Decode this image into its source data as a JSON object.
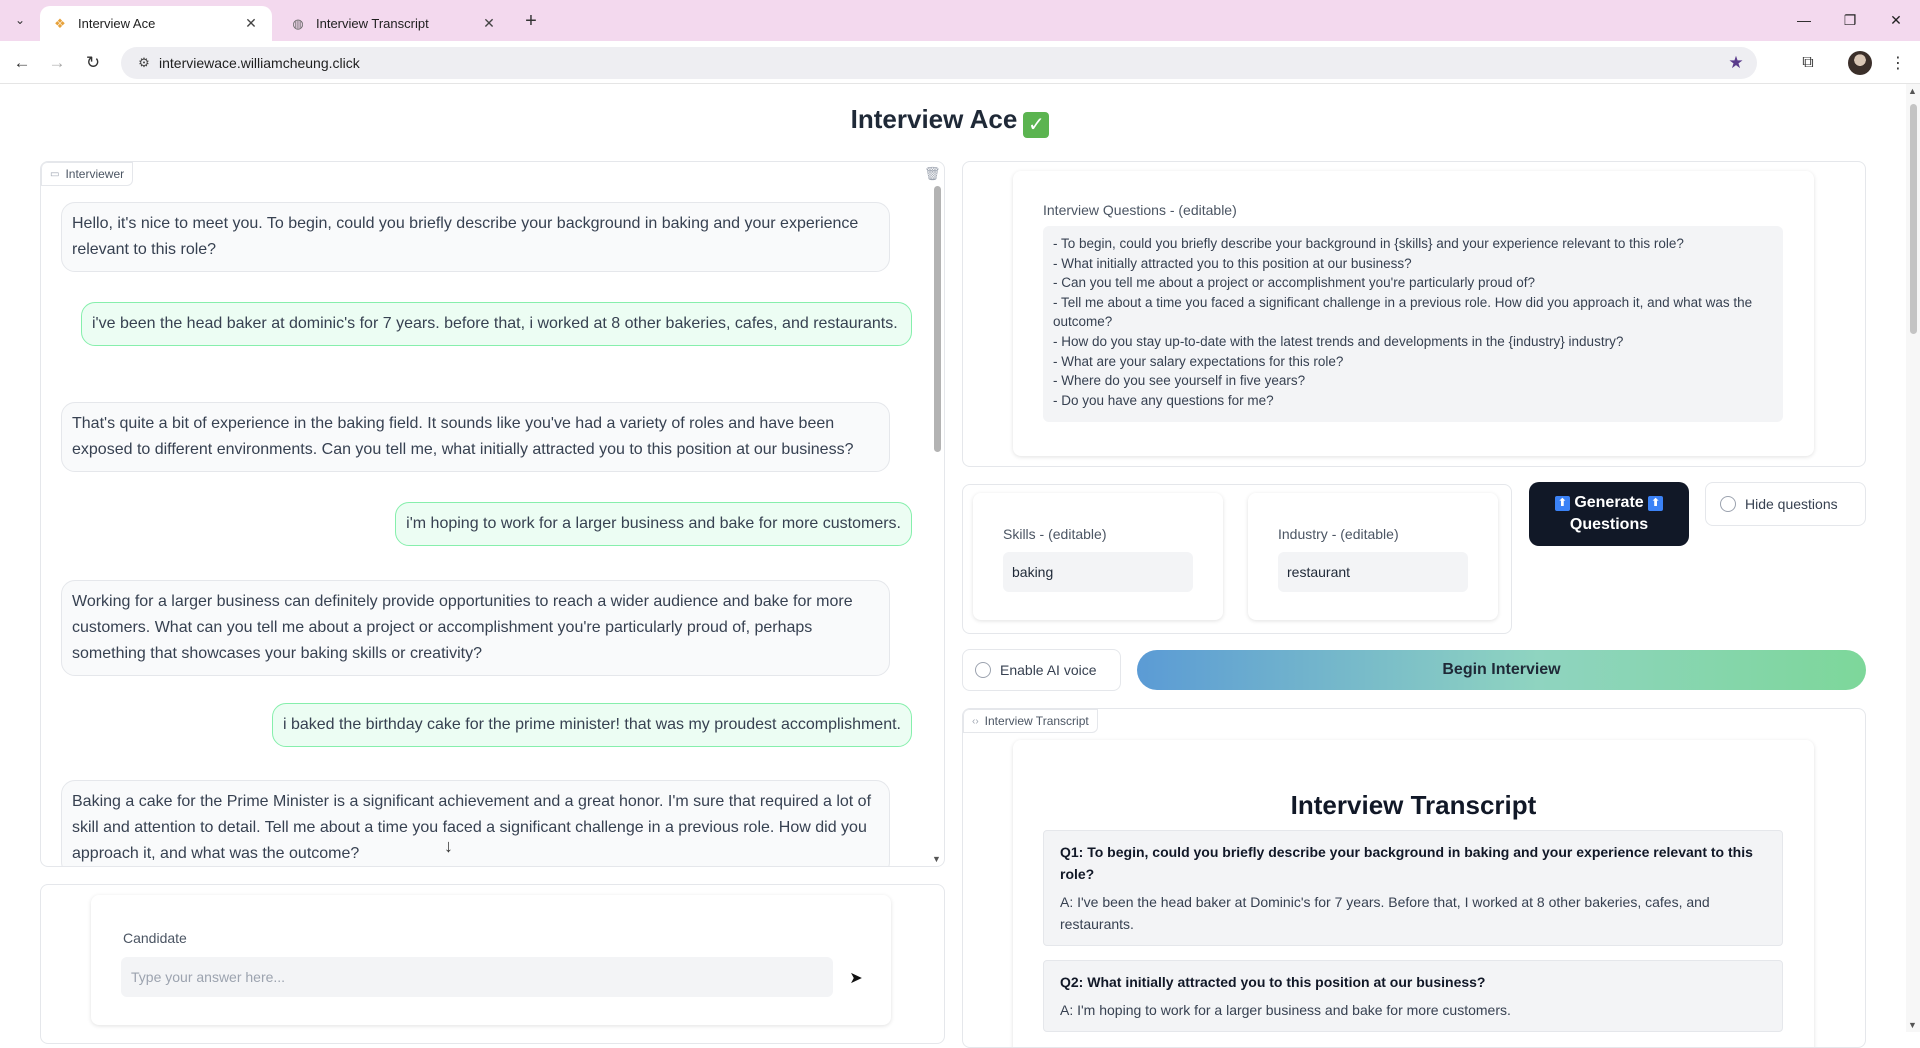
{
  "browser": {
    "tabs": [
      {
        "title": "Interview Ace",
        "favicon": "logo-icon",
        "active": true
      },
      {
        "title": "Interview Transcript",
        "favicon": "globe-icon",
        "active": false
      }
    ],
    "url": "interviewace.williamcheung.click"
  },
  "app": {
    "title": "Interview Ace",
    "title_emoji": "✓"
  },
  "chat": {
    "tag": "Interviewer",
    "messages": [
      {
        "role": "bot",
        "text": "Hello, it's nice to meet you. To begin, could you briefly describe your background in baking and your experience relevant to this role?"
      },
      {
        "role": "user",
        "text": "i've been the head baker at dominic's for 7 years. before that, i worked at 8 other bakeries, cafes, and restaurants."
      },
      {
        "role": "bot",
        "text": "That's quite a bit of experience in the baking field. It sounds like you've had a variety of roles and have been exposed to different environments. Can you tell me, what initially attracted you to this position at our business?"
      },
      {
        "role": "user",
        "text": "i'm hoping to work for a larger business and bake for more customers."
      },
      {
        "role": "bot",
        "text": "Working for a larger business can definitely provide opportunities to reach a wider audience and bake for more customers. What can you tell me about a project or accomplishment you're particularly proud of, perhaps something that showcases your baking skills or creativity?"
      },
      {
        "role": "user",
        "text": "i baked the birthday cake for the prime minister! that was my proudest accomplishment."
      },
      {
        "role": "bot",
        "text": "Baking a cake for the Prime Minister is a significant achievement and a great honor. I'm sure that required a lot of skill and attention to detail. Tell me about a time you faced a significant challenge in a previous role. How did you approach it, and what was the outcome?"
      }
    ]
  },
  "candidate": {
    "label": "Candidate",
    "placeholder": "Type your answer here..."
  },
  "questions": {
    "label": "Interview Questions - (editable)",
    "lines": [
      "- To begin, could you briefly describe your background in {skills} and your experience relevant to this role?",
      "- What initially attracted you to this position at our business?",
      "- Can you tell me about a project or accomplishment you're particularly proud of?",
      "- Tell me about a time you faced a significant challenge in a previous role. How did you approach it, and what was the outcome?",
      "- How do you stay up-to-date with the latest trends and developments in the {industry} industry?",
      "- What are your salary expectations for this role?",
      "- Where do you see yourself in five years?",
      "- Do you have any questions for me?"
    ]
  },
  "skills": {
    "label": "Skills - (editable)",
    "value": "baking"
  },
  "industry": {
    "label": "Industry - (editable)",
    "value": "restaurant"
  },
  "buttons": {
    "generate_line1": "Generate",
    "generate_line2": "Questions",
    "generate_emoji": "⬆",
    "hide_questions": "Hide questions",
    "enable_voice": "Enable AI voice",
    "begin_interview": "Begin Interview"
  },
  "transcript": {
    "tag": "Interview Transcript",
    "title": "Interview Transcript",
    "items": [
      {
        "q": "Q1:  To begin, could you briefly describe your background in baking and your experience relevant to this role?",
        "a": "A: I've been the head baker at Dominic's for 7 years. Before that, I worked at 8 other bakeries, cafes, and restaurants."
      },
      {
        "q": "Q2:  What initially attracted you to this position at our business?",
        "a": "A: I'm hoping to work for a larger business and bake for more customers."
      }
    ]
  },
  "colors": {
    "tabstrip": "#f3d9ee",
    "user_bubble": "#ecfdf3",
    "user_border": "#86efac",
    "generate_bg": "#111827",
    "begin_gradient_start": "#5b9bd5",
    "begin_gradient_end": "#7dd79a"
  }
}
